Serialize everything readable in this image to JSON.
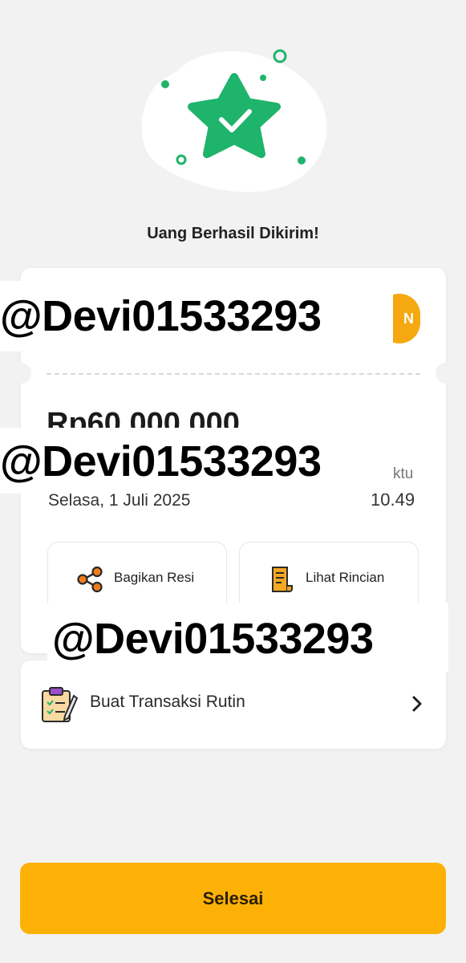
{
  "hero": {
    "icon": "star-check-icon"
  },
  "title": "Uang Berhasil Dikirim!",
  "receipt": {
    "logo_text": "N",
    "amount": "Rp60.000.000",
    "time_label": "ktu",
    "date": "Selasa, 1 Juli 2025",
    "time": "10.49"
  },
  "actions": {
    "share_label": "Bagikan Resi",
    "detail_label": "Lihat Rincian"
  },
  "routine": {
    "label": "Buat Transaksi Rutin"
  },
  "watermarks": [
    "@Devi01533293",
    "@Devi01533293",
    "@Devi01533293"
  ],
  "cta": {
    "label": "Selesai"
  },
  "colors": {
    "primary": "#fdb107",
    "success": "#1fb46b",
    "accent_orange": "#f07d1a"
  }
}
